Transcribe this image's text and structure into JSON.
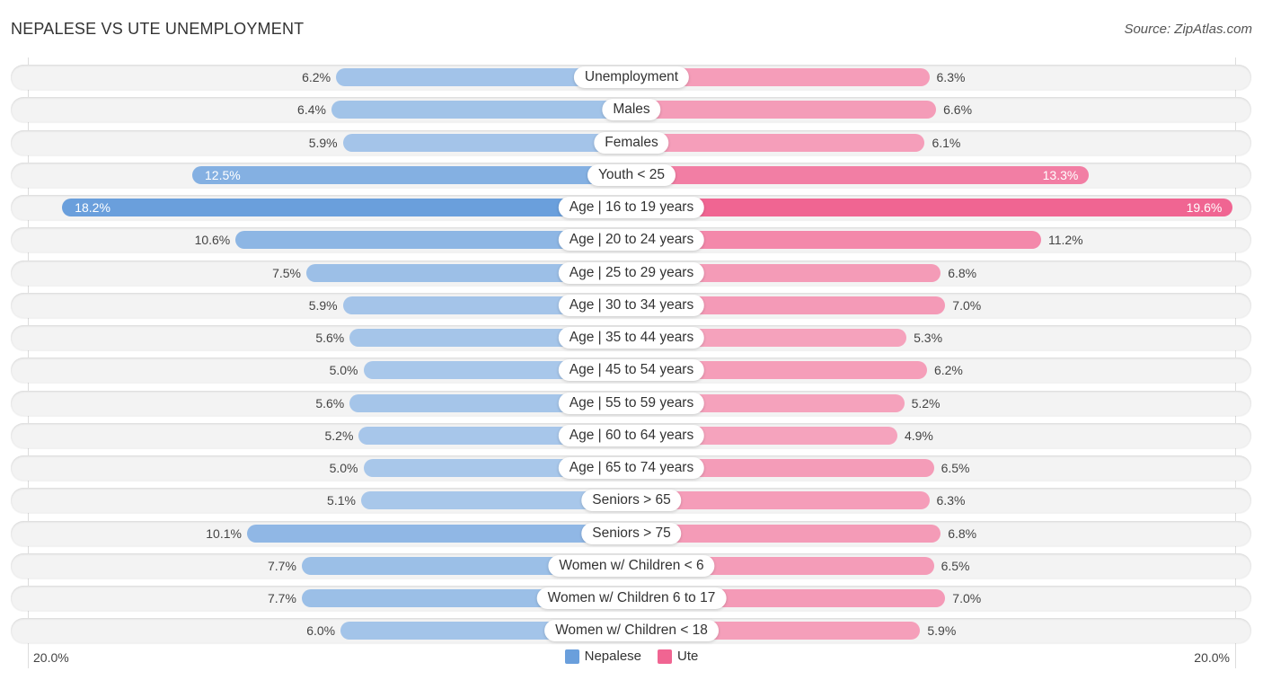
{
  "header": {
    "title": "NEPALESE VS UTE UNEMPLOYMENT",
    "source": "Source: ZipAtlas.com"
  },
  "colors": {
    "nepalese": "#6a9fdc",
    "nepalese_light": "#a8c7ea",
    "ute": "#f06592",
    "ute_light": "#f5a3bd"
  },
  "chart_data": {
    "type": "bar",
    "orientation": "horizontal-diverging",
    "title": "NEPALESE VS UTE UNEMPLOYMENT",
    "xlabel": "",
    "ylabel": "",
    "xlim": [
      0,
      20
    ],
    "axis_tick_labels": {
      "left": "20.0%",
      "right": "20.0%"
    },
    "legend": {
      "placement": "bottom-center",
      "entries": [
        "Nepalese",
        "Ute"
      ]
    },
    "categories": [
      "Unemployment",
      "Males",
      "Females",
      "Youth < 25",
      "Age | 16 to 19 years",
      "Age | 20 to 24 years",
      "Age | 25 to 29 years",
      "Age | 30 to 34 years",
      "Age | 35 to 44 years",
      "Age | 45 to 54 years",
      "Age | 55 to 59 years",
      "Age | 60 to 64 years",
      "Age | 65 to 74 years",
      "Seniors > 65",
      "Seniors > 75",
      "Women w/ Children < 6",
      "Women w/ Children 6 to 17",
      "Women w/ Children < 18"
    ],
    "series": [
      {
        "name": "Nepalese",
        "side": "left",
        "values": [
          6.2,
          6.4,
          5.9,
          12.5,
          18.2,
          10.6,
          7.5,
          5.9,
          5.6,
          5.0,
          5.6,
          5.2,
          5.0,
          5.1,
          10.1,
          7.7,
          7.7,
          6.0
        ],
        "labels": [
          "6.2%",
          "6.4%",
          "5.9%",
          "12.5%",
          "18.2%",
          "10.6%",
          "7.5%",
          "5.9%",
          "5.6%",
          "5.0%",
          "5.6%",
          "5.2%",
          "5.0%",
          "5.1%",
          "10.1%",
          "7.7%",
          "7.7%",
          "6.0%"
        ]
      },
      {
        "name": "Ute",
        "side": "right",
        "values": [
          6.3,
          6.6,
          6.1,
          13.3,
          19.6,
          11.2,
          6.8,
          7.0,
          5.3,
          6.2,
          5.2,
          4.9,
          6.5,
          6.3,
          6.8,
          6.5,
          7.0,
          5.9
        ],
        "labels": [
          "6.3%",
          "6.6%",
          "6.1%",
          "13.3%",
          "19.6%",
          "11.2%",
          "6.8%",
          "7.0%",
          "5.3%",
          "6.2%",
          "5.2%",
          "4.9%",
          "6.5%",
          "6.3%",
          "6.8%",
          "6.5%",
          "7.0%",
          "5.9%"
        ]
      }
    ]
  }
}
